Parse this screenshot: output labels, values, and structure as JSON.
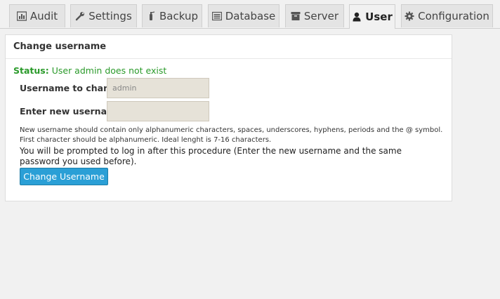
{
  "tabs": [
    {
      "label": "Audit",
      "icon": "bar-chart-icon"
    },
    {
      "label": "Settings",
      "icon": "wrench-icon"
    },
    {
      "label": "Backup",
      "icon": "fire-extinguisher-icon"
    },
    {
      "label": "Database",
      "icon": "list-icon"
    },
    {
      "label": "Server",
      "icon": "archive-icon"
    },
    {
      "label": "User",
      "icon": "user-icon",
      "active": true
    },
    {
      "label": "Configuration",
      "icon": "gear-icon"
    }
  ],
  "panel": {
    "title": "Change username",
    "status_label": "Status:",
    "status_text": "User admin does not exist",
    "username_label": "Username to change:",
    "username_value": "admin",
    "new_username_label": "Enter new username:",
    "new_username_value": "",
    "help_line1": "New username should contain only alphanumeric characters, spaces, underscores, hyphens, periods and the @ symbol.",
    "help_line2": "First character should be alphanumeric. Ideal lenght is 7-16 characters.",
    "note": "You will be prompted to log in after this procedure (Enter the new username and the same password you used before).",
    "button_label": "Change Username"
  },
  "colors": {
    "accent": "#2a9fd6",
    "status": "#2a9a2a",
    "field_bg": "#e6e2d8"
  }
}
